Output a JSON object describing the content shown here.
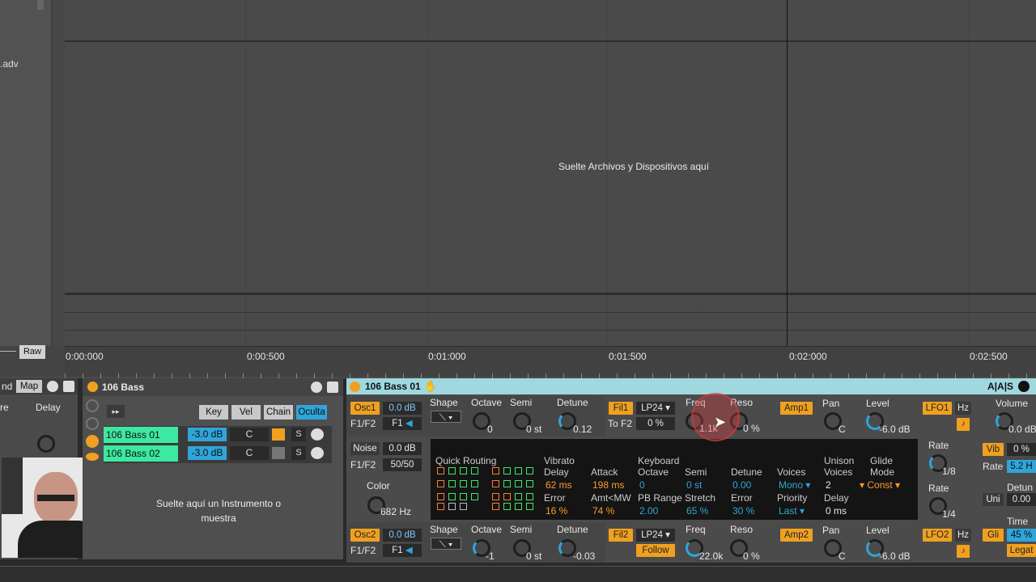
{
  "arrangement": {
    "file_label": ".adv",
    "drop_hint": "Suelte Archivos y Dispositivos aquí",
    "raw_button": "Raw",
    "timeline": [
      "0:00:000",
      "0:00:500",
      "0:01:000",
      "0:01:500",
      "0:02:000",
      "0:02:500"
    ]
  },
  "left_device": {
    "labels": [
      "nd",
      "Map"
    ],
    "sub_labels": [
      "re",
      "Delay"
    ]
  },
  "rack": {
    "title": "106 Bass",
    "buttons": [
      "Key",
      "Vel",
      "Chain",
      "Oculta"
    ],
    "chains": [
      {
        "name": "106 Bass 01",
        "volume": "-3.0 dB",
        "pan": "C",
        "solo": "S"
      },
      {
        "name": "106 Bass 02",
        "volume": "-3.0 dB",
        "pan": "C",
        "solo": "S"
      }
    ],
    "drop_hint": "Suelte aquí un Instrumento o muestra"
  },
  "synth": {
    "title": "106 Bass 01",
    "osc1": {
      "label": "Osc1",
      "gain": "0.0 dB",
      "route_label": "F1/F2",
      "route": "F1",
      "shape": "Shape",
      "octave": "Octave",
      "octave_val": "0",
      "semi": "Semi",
      "semi_val": "0 st",
      "detune": "Detune",
      "detune_val": "0.12"
    },
    "noise": {
      "label": "Noise",
      "gain": "0.0 dB",
      "route_label": "F1/F2",
      "route": "50/50",
      "color": "Color",
      "color_val": "682 Hz"
    },
    "osc2": {
      "label": "Osc2",
      "gain": "0.0 dB",
      "route_label": "F1/F2",
      "route": "F1",
      "shape": "Shape",
      "octave": "Octave",
      "octave_val": "-1",
      "semi": "Semi",
      "semi_val": "0 st",
      "detune": "Detune",
      "detune_val": "-0.03"
    },
    "fil1": {
      "label": "Fil1",
      "type": "LP24",
      "to": "To F2",
      "to_val": "0 %",
      "freq": "Freq",
      "freq_val": "1.1k",
      "reso": "Reso",
      "reso_val": "0 %"
    },
    "fil2": {
      "label": "Fil2",
      "type": "LP24",
      "follow": "Follow",
      "freq": "Freq",
      "freq_val": "22.0k",
      "reso": "Reso",
      "reso_val": "0 %"
    },
    "amp1": {
      "label": "Amp1",
      "pan": "Pan",
      "pan_val": "C",
      "level": "Level",
      "level_val": "-6.0 dB"
    },
    "amp2": {
      "label": "Amp2",
      "pan": "Pan",
      "pan_val": "C",
      "level": "Level",
      "level_val": "-6.0 dB"
    },
    "global": {
      "quick_routing": "Quick Routing",
      "vibrato": "Vibrato",
      "delay": "Delay",
      "delay_val": "62 ms",
      "attack": "Attack",
      "attack_val": "198 ms",
      "error": "Error",
      "error_val": "16 %",
      "amt_mw": "Amt<MW",
      "amt_mw_val": "74 %",
      "keyboard": "Keyboard",
      "kb_octave": "Octave",
      "kb_octave_val": "0",
      "kb_semi": "Semi",
      "kb_semi_val": "0 st",
      "kb_detune": "Detune",
      "kb_detune_val": "0.00",
      "pb_range": "PB Range",
      "pb_range_val": "2.00",
      "stretch": "Stretch",
      "stretch_val": "65 %",
      "kb_error": "Error",
      "kb_error_val": "30 %",
      "voices": "Voices",
      "voices_val": "Mono",
      "priority": "Priority",
      "priority_val": "Last",
      "unison": "Unison",
      "unison_voices": "Voices",
      "unison_voices_val": "2",
      "unison_delay": "Delay",
      "unison_delay_val": "0 ms",
      "glide": "Glide",
      "glide_mode": "Mode",
      "glide_mode_val": "Const"
    },
    "lfo1": {
      "label": "LFO1",
      "unit": "Hz",
      "rate": "Rate",
      "rate_val": "1/8",
      "rate2": "Rate",
      "rate2_val": "1/4"
    },
    "lfo2": {
      "label": "LFO2",
      "unit": "Hz"
    },
    "right": {
      "volume": "Volume",
      "volume_val": "0.0 dB",
      "vib": "Vib",
      "vib_val": "0 %",
      "rate": "Rate",
      "rate_val": "5.2 H",
      "detune": "Detun",
      "uni": "Uni",
      "uni_val": "0.00",
      "time": "Time",
      "gli": "Gli",
      "gli_val": "45 %",
      "legato": "Legat"
    }
  },
  "colors": {
    "accent": "#f0a020",
    "chain": "#3de8a0",
    "value": "#7ec8ff",
    "orange_value": "#ff9a2e"
  }
}
